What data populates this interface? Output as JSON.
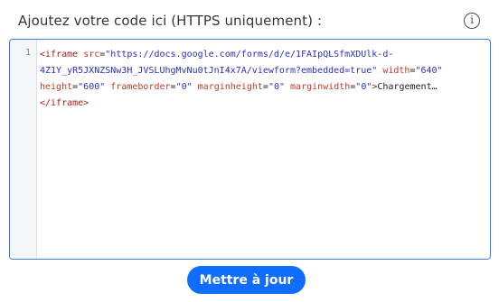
{
  "panel": {
    "label": "Ajoutez votre code ici (HTTPS uniquement) :",
    "info_icon": "info-circle-icon",
    "info_glyph": "i"
  },
  "editor": {
    "line_number": "1",
    "lines": [
      [
        {
          "t": "tag",
          "v": "<iframe"
        },
        {
          "t": "txt",
          "v": " "
        },
        {
          "t": "attr",
          "v": "src"
        },
        {
          "t": "txt",
          "v": "="
        },
        {
          "t": "str",
          "v": "\"https://docs.google.com/forms/d/e/1FAIpQLSfmXDUlk-d-"
        }
      ],
      [
        {
          "t": "str",
          "v": "4Z1Y_yR5JXNZSNw3H_JVSLUhgMvNu0tJnI4x7A/viewform?embedded=true\""
        },
        {
          "t": "txt",
          "v": " "
        },
        {
          "t": "attr",
          "v": "width"
        },
        {
          "t": "txt",
          "v": "="
        },
        {
          "t": "str",
          "v": "\"640\""
        }
      ],
      [
        {
          "t": "attr",
          "v": "height"
        },
        {
          "t": "txt",
          "v": "="
        },
        {
          "t": "str",
          "v": "\"600\""
        },
        {
          "t": "txt",
          "v": " "
        },
        {
          "t": "attr",
          "v": "frameborder"
        },
        {
          "t": "txt",
          "v": "="
        },
        {
          "t": "str",
          "v": "\"0\""
        },
        {
          "t": "txt",
          "v": " "
        },
        {
          "t": "attr",
          "v": "marginheight"
        },
        {
          "t": "txt",
          "v": "="
        },
        {
          "t": "str",
          "v": "\"0\""
        },
        {
          "t": "txt",
          "v": " "
        },
        {
          "t": "attr",
          "v": "marginwidth"
        },
        {
          "t": "txt",
          "v": "="
        },
        {
          "t": "str",
          "v": "\"0\""
        },
        {
          "t": "tag",
          "v": ">"
        },
        {
          "t": "txt",
          "v": "Chargement…"
        }
      ],
      [
        {
          "t": "tag",
          "v": "</iframe>"
        }
      ]
    ]
  },
  "actions": {
    "update_label": "Mettre à jour"
  },
  "colors": {
    "accent": "#116dff",
    "editor_border": "#3b78e7",
    "tag": "#a11b1b",
    "attribute": "#c0392b",
    "string": "#2a2fbf"
  }
}
